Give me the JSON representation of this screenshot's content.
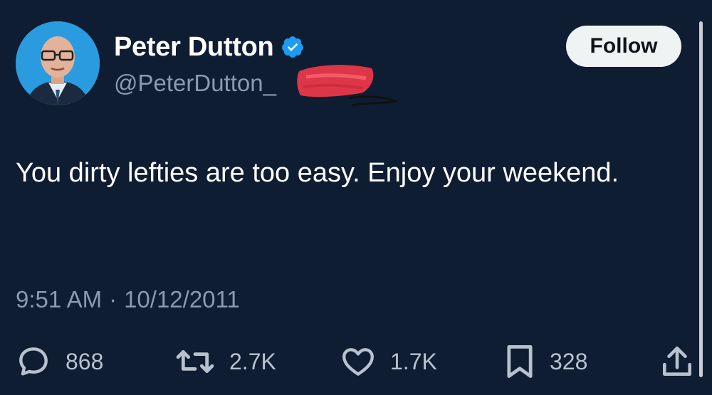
{
  "user": {
    "display_name": "Peter Dutton",
    "handle": "@PeterDutton_",
    "verified": true,
    "avatar_icon": "profile-photo-icon"
  },
  "follow_label": "Follow",
  "tweet": {
    "text": "You dirty lefties are too easy. Enjoy your weekend.",
    "time": "9:51 AM",
    "separator": "·",
    "date": "10/12/2011"
  },
  "stats": {
    "replies": "868",
    "retweets": "2.7K",
    "likes": "1.7K",
    "bookmarks": "328"
  },
  "icons": {
    "reply": "speech-bubble-icon",
    "retweet": "retweet-arrows-icon",
    "like": "heart-icon",
    "bookmark": "bookmark-icon",
    "share": "share-upload-icon",
    "verified": "verified-badge-icon"
  },
  "colors": {
    "background": "#0f1d33",
    "secondary_text": "#8c9aae",
    "verified_blue": "#1d9bf0",
    "redaction": "#e8384a"
  }
}
